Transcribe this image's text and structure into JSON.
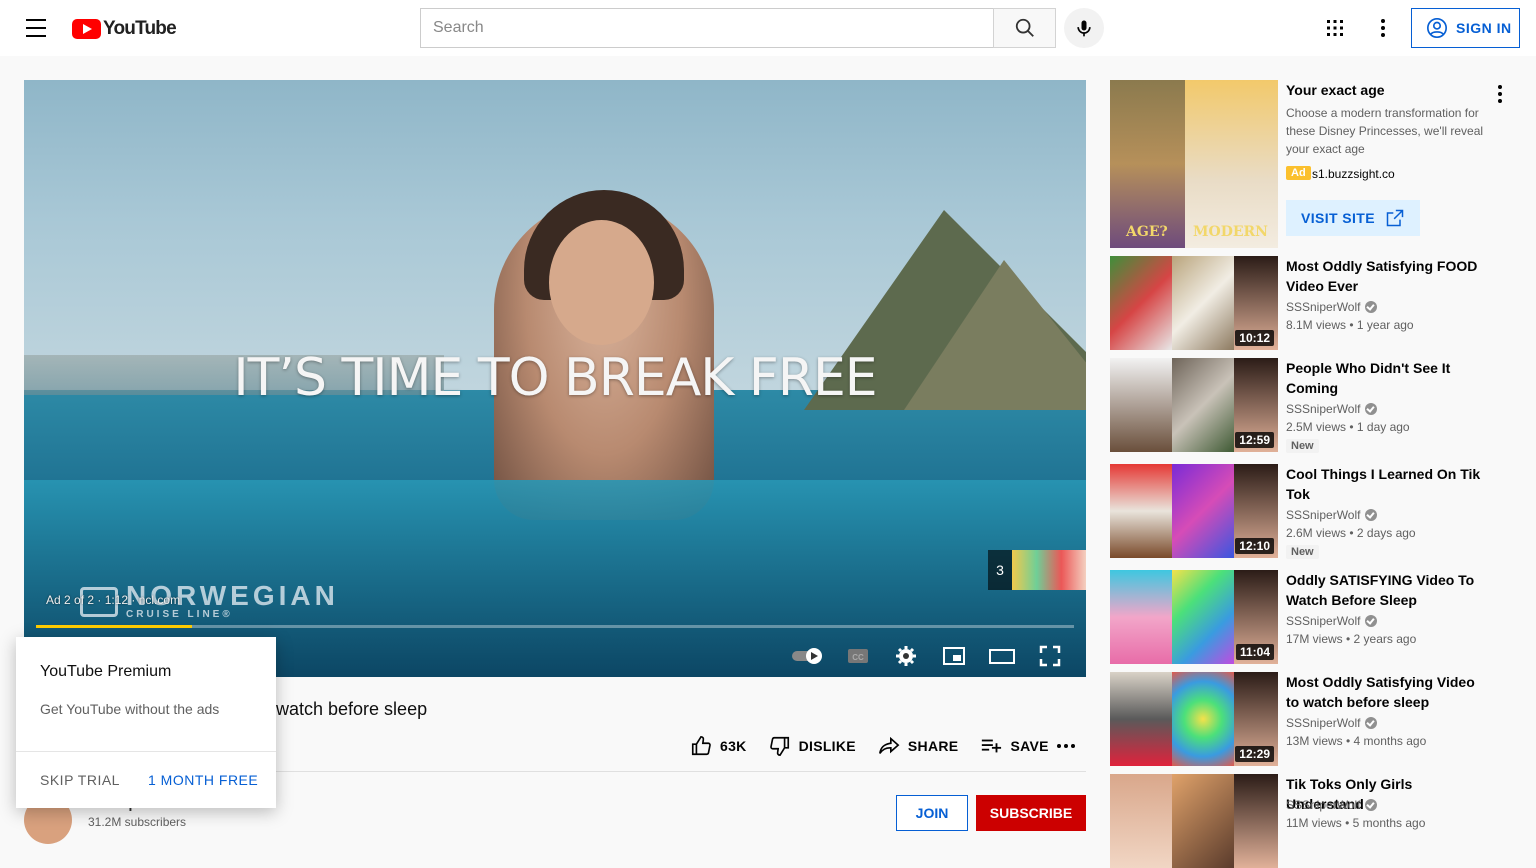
{
  "header": {
    "logo_text": "YouTube",
    "search_placeholder": "Search",
    "signin_label": "SIGN IN"
  },
  "player": {
    "headline": "IT’S TIME TO BREAK FREE",
    "brand_name": "NORWEGIAN",
    "brand_sub": "CRUISE LINE®",
    "ad_info": "Ad 2 of 2 · 1:12 · ncl.com",
    "skip_count": "3",
    "progress_fraction": 0.15
  },
  "video": {
    "title_partial": "watch before sleep",
    "like_count": "63K",
    "dislike_label": "DISLIKE",
    "share_label": "SHARE",
    "save_label": "SAVE",
    "join_label": "JOIN",
    "subscribe_label": "SUBSCRIBE",
    "channel_name": "SSSniperWolf",
    "channel_subs": "31.2M subscribers"
  },
  "premium_popup": {
    "title": "YouTube Premium",
    "subtitle": "Get YouTube without the ads",
    "skip_label": "SKIP TRIAL",
    "free_label": "1 MONTH FREE"
  },
  "sidebar_ad": {
    "title": "Your exact age",
    "description": "Choose a modern transformation for these Disney Princesses, we'll reveal your exact age",
    "badge": "Ad",
    "domain": "s1.buzzsight.co",
    "visit_label": "VISIT SITE",
    "thumb_left_label": "AGE?",
    "thumb_right_label": "MODERN"
  },
  "recommendations": [
    {
      "title": "Most Oddly Satisfying FOOD Video Ever",
      "channel": "SSSniperWolf",
      "meta": "8.1M views • 1 year ago",
      "duration": "10:12",
      "badge": ""
    },
    {
      "title": "People Who Didn't See It Coming",
      "channel": "SSSniperWolf",
      "meta": "2.5M views • 1 day ago",
      "duration": "12:59",
      "badge": "New"
    },
    {
      "title": "Cool Things I Learned On Tik Tok",
      "channel": "SSSniperWolf",
      "meta": "2.6M views • 2 days ago",
      "duration": "12:10",
      "badge": "New"
    },
    {
      "title": "Oddly SATISFYING Video To Watch Before Sleep",
      "channel": "SSSniperWolf",
      "meta": "17M views • 2 years ago",
      "duration": "11:04",
      "badge": ""
    },
    {
      "title": "Most Oddly Satisfying Video to watch before sleep",
      "channel": "SSSniperWolf",
      "meta": "13M views • 4 months ago",
      "duration": "12:29",
      "badge": ""
    },
    {
      "title": "Tik Toks Only Girls Understand",
      "channel": "SSSniperWolf",
      "meta": "11M views • 5 months ago",
      "duration": "",
      "badge": ""
    }
  ],
  "colors": {
    "brand_red": "#ff0000",
    "link_blue": "#065fd4",
    "subscribe_red": "#cc0000",
    "ad_progress": "#ffcc00"
  }
}
